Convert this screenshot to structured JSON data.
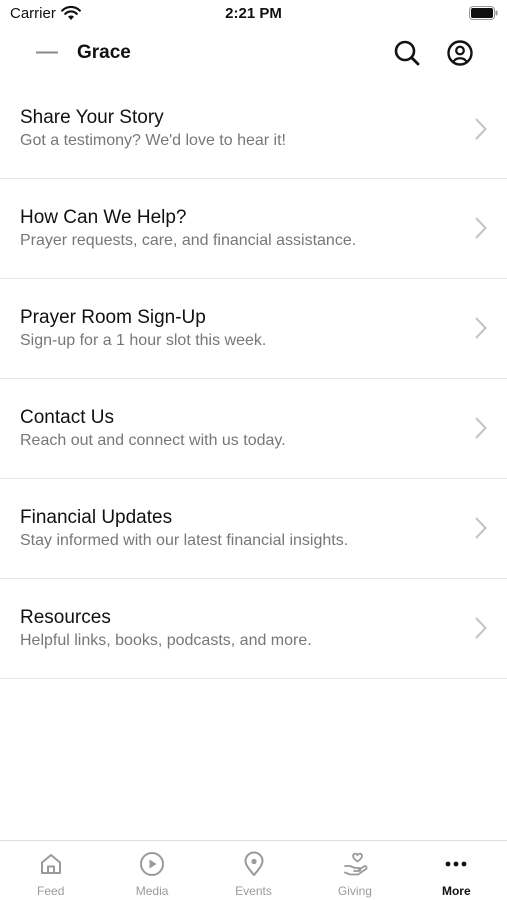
{
  "status_bar": {
    "carrier": "Carrier",
    "time": "2:21 PM"
  },
  "header": {
    "title": "Grace"
  },
  "menu": [
    {
      "title": "Share Your Story",
      "subtitle": "Got a testimony? We'd love to hear it!"
    },
    {
      "title": "How Can We Help?",
      "subtitle": "Prayer requests, care, and financial assistance."
    },
    {
      "title": "Prayer Room Sign-Up",
      "subtitle": "Sign-up for a 1 hour slot this week."
    },
    {
      "title": "Contact Us",
      "subtitle": "Reach out and connect with us today."
    },
    {
      "title": "Financial Updates",
      "subtitle": "Stay informed with our latest financial insights."
    },
    {
      "title": "Resources",
      "subtitle": "Helpful links, books, podcasts, and more."
    }
  ],
  "tabs": [
    {
      "label": "Feed",
      "icon": "home-icon"
    },
    {
      "label": "Media",
      "icon": "play-circle-icon"
    },
    {
      "label": "Events",
      "icon": "location-pin-icon"
    },
    {
      "label": "Giving",
      "icon": "giving-hand-icon"
    },
    {
      "label": "More",
      "icon": "more-dots-icon",
      "active": true
    }
  ],
  "colors": {
    "inactive_tab": "#9a9a9a",
    "active_tab": "#111111",
    "subtitle": "#777777",
    "divider": "#e6e6e6"
  }
}
